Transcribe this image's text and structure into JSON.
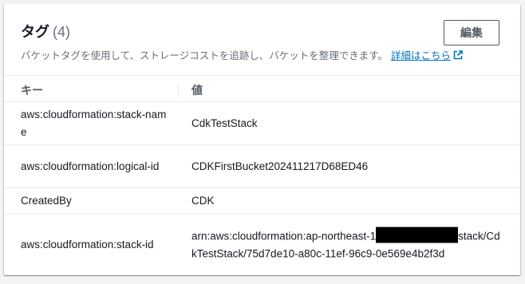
{
  "header": {
    "title": "タグ",
    "count": "(4)",
    "description": "バケットタグを使用して、ストレージコストを追跡し、バケットを整理できます。",
    "link_label": "詳細はこちら",
    "edit_label": "編集"
  },
  "table": {
    "columns": [
      "キー",
      "値"
    ],
    "rows": [
      {
        "key": "aws:cloudformation:stack-name",
        "value": "CdkTestStack"
      },
      {
        "key": "aws:cloudformation:logical-id",
        "value": "CDKFirstBucket202411217D68ED46"
      },
      {
        "key": "CreatedBy",
        "value": "CDK"
      },
      {
        "key": "aws:cloudformation:stack-id",
        "value_prefix": "arn:aws:cloudformation:ap-northeast-1",
        "value_suffix": "stack/CdkTestStack/75d7de10-a80c-11ef-96c9-0e569e4b2f3d"
      }
    ]
  },
  "colors": {
    "link": "#0073bb",
    "muted": "#687078",
    "border": "#eaeded"
  }
}
